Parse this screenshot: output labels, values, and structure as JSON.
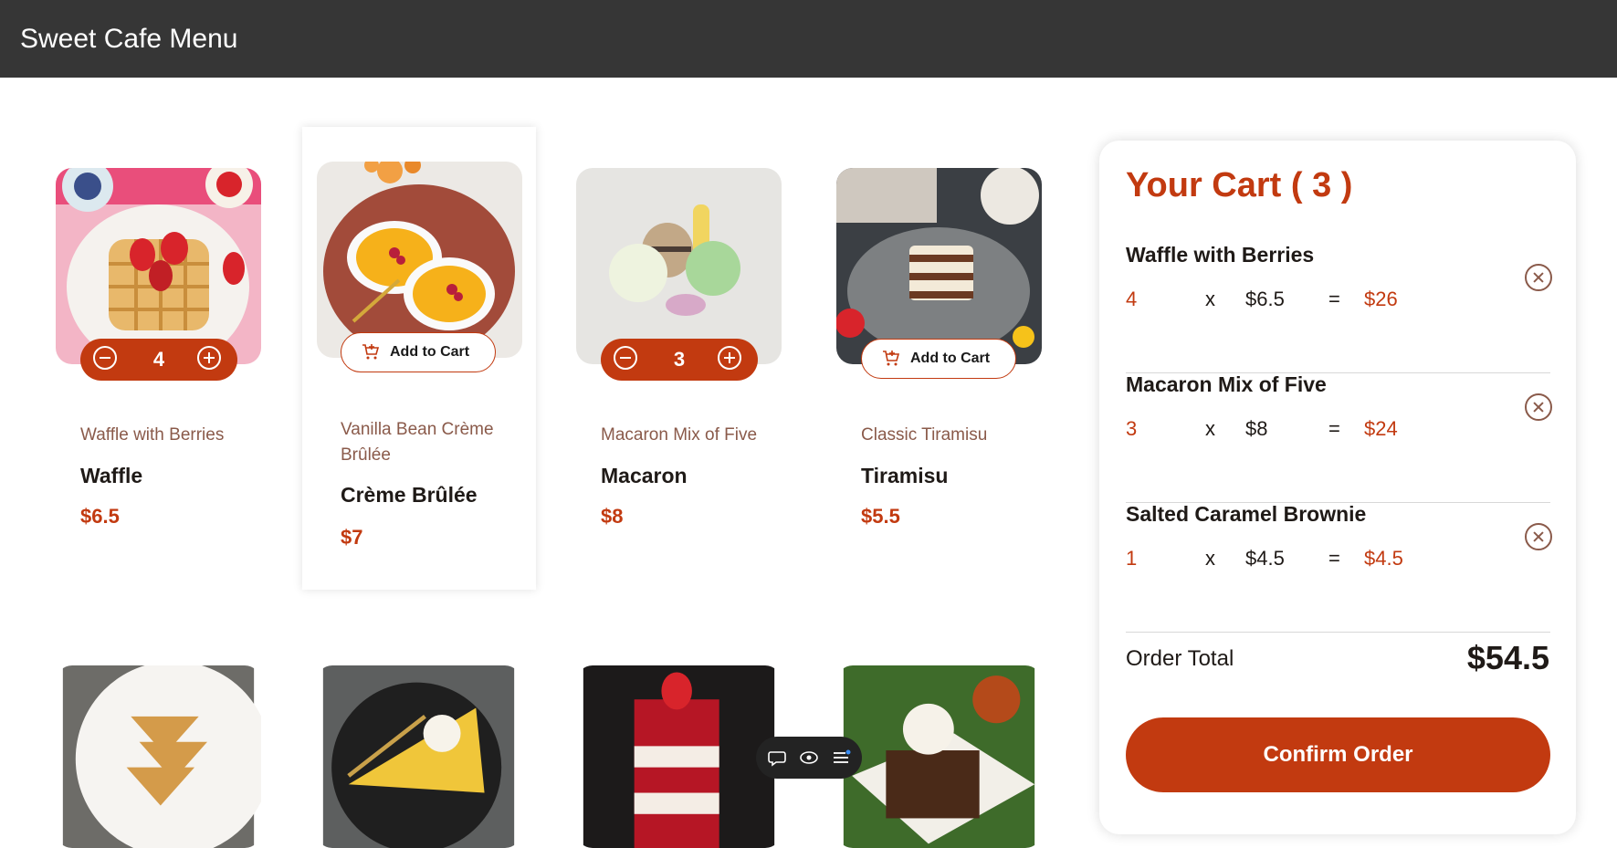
{
  "header": {
    "title": "Sweet Cafe Menu"
  },
  "menu": {
    "items": [
      {
        "category": "Waffle with Berries",
        "name": "Waffle",
        "price": "$6.5",
        "quantity": "4",
        "image": "waffle-with-berries-photo"
      },
      {
        "category": "Vanilla Bean Crème Brûlée",
        "name": "Crème Brûlée",
        "price": "$7",
        "add_label": "Add to Cart",
        "image": "creme-brulee-photo"
      },
      {
        "category": "Macaron Mix of Five",
        "name": "Macaron",
        "price": "$8",
        "quantity": "3",
        "image": "macarons-photo"
      },
      {
        "category": "Classic Tiramisu",
        "name": "Tiramisu",
        "price": "$5.5",
        "add_label": "Add to Cart",
        "image": "tiramisu-photo"
      },
      {
        "image": "baklava-photo"
      },
      {
        "image": "pie-slice-photo"
      },
      {
        "image": "red-velvet-cake-photo"
      },
      {
        "image": "brownie-photo"
      }
    ]
  },
  "cart": {
    "title": "Your Cart ( 3 )",
    "items": [
      {
        "name": "Waffle with Berries",
        "qty": "4",
        "x": "x",
        "unit": "$6.5",
        "eq": "=",
        "line_total": "$26"
      },
      {
        "name": "Macaron Mix of Five",
        "qty": "3",
        "x": "x",
        "unit": "$8",
        "eq": "=",
        "line_total": "$24"
      },
      {
        "name": "Salted Caramel Brownie",
        "qty": "1",
        "x": "x",
        "unit": "$4.5",
        "eq": "=",
        "line_total": "$4.5"
      }
    ],
    "total_label": "Order Total",
    "total_value": "$54.5",
    "confirm_label": "Confirm Order"
  },
  "toolbar": {
    "icons": [
      "comment-icon",
      "eye-icon",
      "list-icon"
    ]
  },
  "colors": {
    "accent": "#c23a10",
    "header_bg": "#363636",
    "muted": "#8a5a4a"
  }
}
